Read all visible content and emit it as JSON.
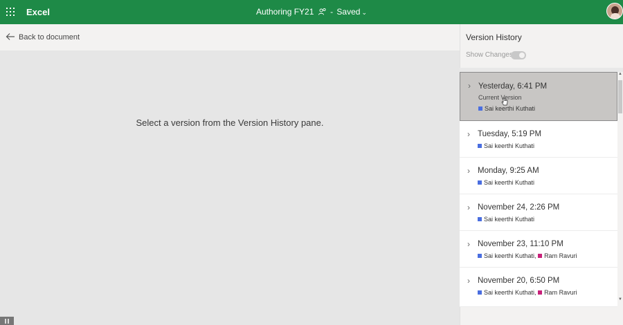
{
  "topbar": {
    "app_name": "Excel",
    "document_title": "Authoring FY21",
    "separator": "-",
    "save_status": "Saved"
  },
  "left": {
    "back_label": "Back to document",
    "hint": "Select a version from the Version History pane."
  },
  "version_history": {
    "title": "Version History",
    "show_changes_label": "Show Changes",
    "show_changes_on": false,
    "versions": [
      {
        "date": "Yesterday, 6:41 PM",
        "sublabel": "Current Version",
        "authors": [
          "Sai keerthi Kuthati"
        ],
        "selected": true
      },
      {
        "date": "Tuesday, 5:19 PM",
        "authors": [
          "Sai keerthi Kuthati"
        ]
      },
      {
        "date": "Monday, 9:25 AM",
        "authors": [
          "Sai keerthi Kuthati"
        ]
      },
      {
        "date": "November 24, 2:26 PM",
        "authors": [
          "Sai keerthi Kuthati"
        ]
      },
      {
        "date": "November 23, 11:10 PM",
        "authors": [
          "Sai keerthi Kuthati",
          "Ram Ravuri"
        ]
      },
      {
        "date": "November 20, 6:50 PM",
        "authors": [
          "Sai keerthi Kuthati",
          "Ram Ravuri"
        ]
      }
    ],
    "author_colors": [
      "#4a6ee0",
      "#c8217a"
    ]
  },
  "colors": {
    "brand": "#1e8a47",
    "pane_background": "#f3f2f1",
    "selected_item": "#c8c6c4"
  }
}
